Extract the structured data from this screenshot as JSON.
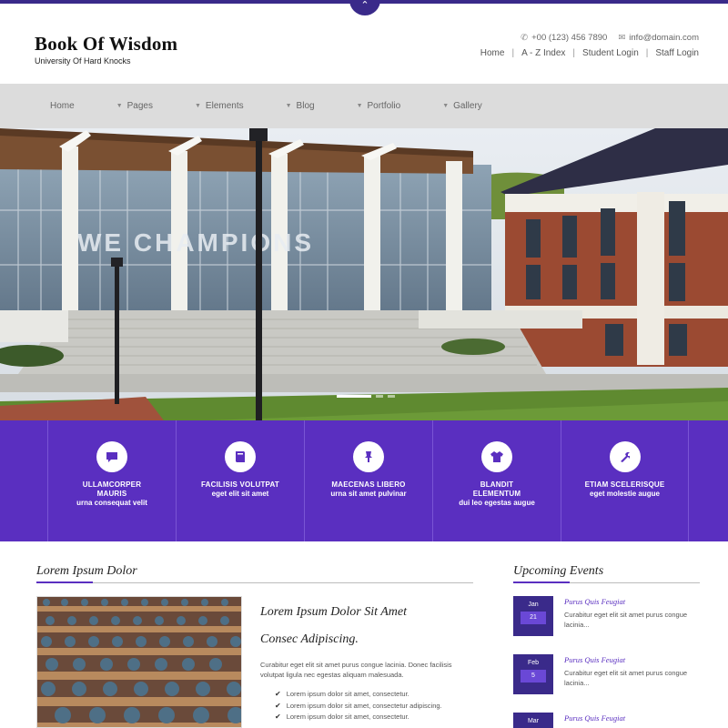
{
  "header": {
    "brand_title": "Book Of Wisdom",
    "brand_subtitle": "University Of Hard Knocks",
    "phone": "+00 (123) 456 7890",
    "email": "info@domain.com",
    "top_links": [
      "Home",
      "A - Z Index",
      "Student Login",
      "Staff Login"
    ]
  },
  "nav": {
    "items": [
      {
        "label": "Home",
        "has_dropdown": false
      },
      {
        "label": "Pages",
        "has_dropdown": true
      },
      {
        "label": "Elements",
        "has_dropdown": true
      },
      {
        "label": "Blog",
        "has_dropdown": true
      },
      {
        "label": "Portfolio",
        "has_dropdown": true
      },
      {
        "label": "Gallery",
        "has_dropdown": true
      }
    ]
  },
  "hero": {
    "banner_text": "WE CHAMPIONS",
    "slide_count": 3,
    "active_slide": 1
  },
  "features": [
    {
      "line1": "ULLAMCORPER",
      "line2": "MAURIS",
      "line3": "urna consequat velit",
      "icon": "chat-icon"
    },
    {
      "line1": "FACILISIS VOLUTPAT",
      "line2": "",
      "line3": "eget elit sit amet",
      "icon": "book-icon"
    },
    {
      "line1": "MAECENAS LIBERO",
      "line2": "",
      "line3": "urna sit amet pulvinar",
      "icon": "pin-icon"
    },
    {
      "line1": "BLANDIT",
      "line2": "ELEMENTUM",
      "line3": "dui leo egestas augue",
      "icon": "shirt-icon"
    },
    {
      "line1": "ETIAM SCELERISQUE",
      "line2": "",
      "line3": "eget molestie augue",
      "icon": "tools-icon"
    }
  ],
  "main": {
    "section_title": "Lorem Ipsum Dolor",
    "article_title": "Lorem Ipsum Dolor Sit Amet",
    "article_subtitle": "Consec Adipiscing.",
    "article_body": "Curabitur eget elit sit amet purus congue lacinia. Donec facilisis volutpat ligula nec egestas aliquam malesuada.",
    "list": [
      "Lorem ipsum dolor sit amet, consectetur.",
      "Lorem ipsum dolor sit amet, consectetur adipiscing.",
      "Lorem ipsum dolor sit amet, consectetur."
    ]
  },
  "events": {
    "title": "Upcoming Events",
    "items": [
      {
        "month": "Jan",
        "day": "21",
        "title": "Purus Quis Feugiat",
        "text": "Curabitur eget elit sit amet purus congue lacinia..."
      },
      {
        "month": "Feb",
        "day": "5",
        "title": "Purus Quis Feugiat",
        "text": "Curabitur eget elit sit amet purus congue lacinia..."
      },
      {
        "month": "Mar",
        "day": "",
        "title": "Purus Quis Feugiat",
        "text": ""
      }
    ]
  },
  "colors": {
    "accent": "#5a2fc0",
    "dark_accent": "#3a2a8a",
    "nav_bg": "#dcdcdc"
  }
}
